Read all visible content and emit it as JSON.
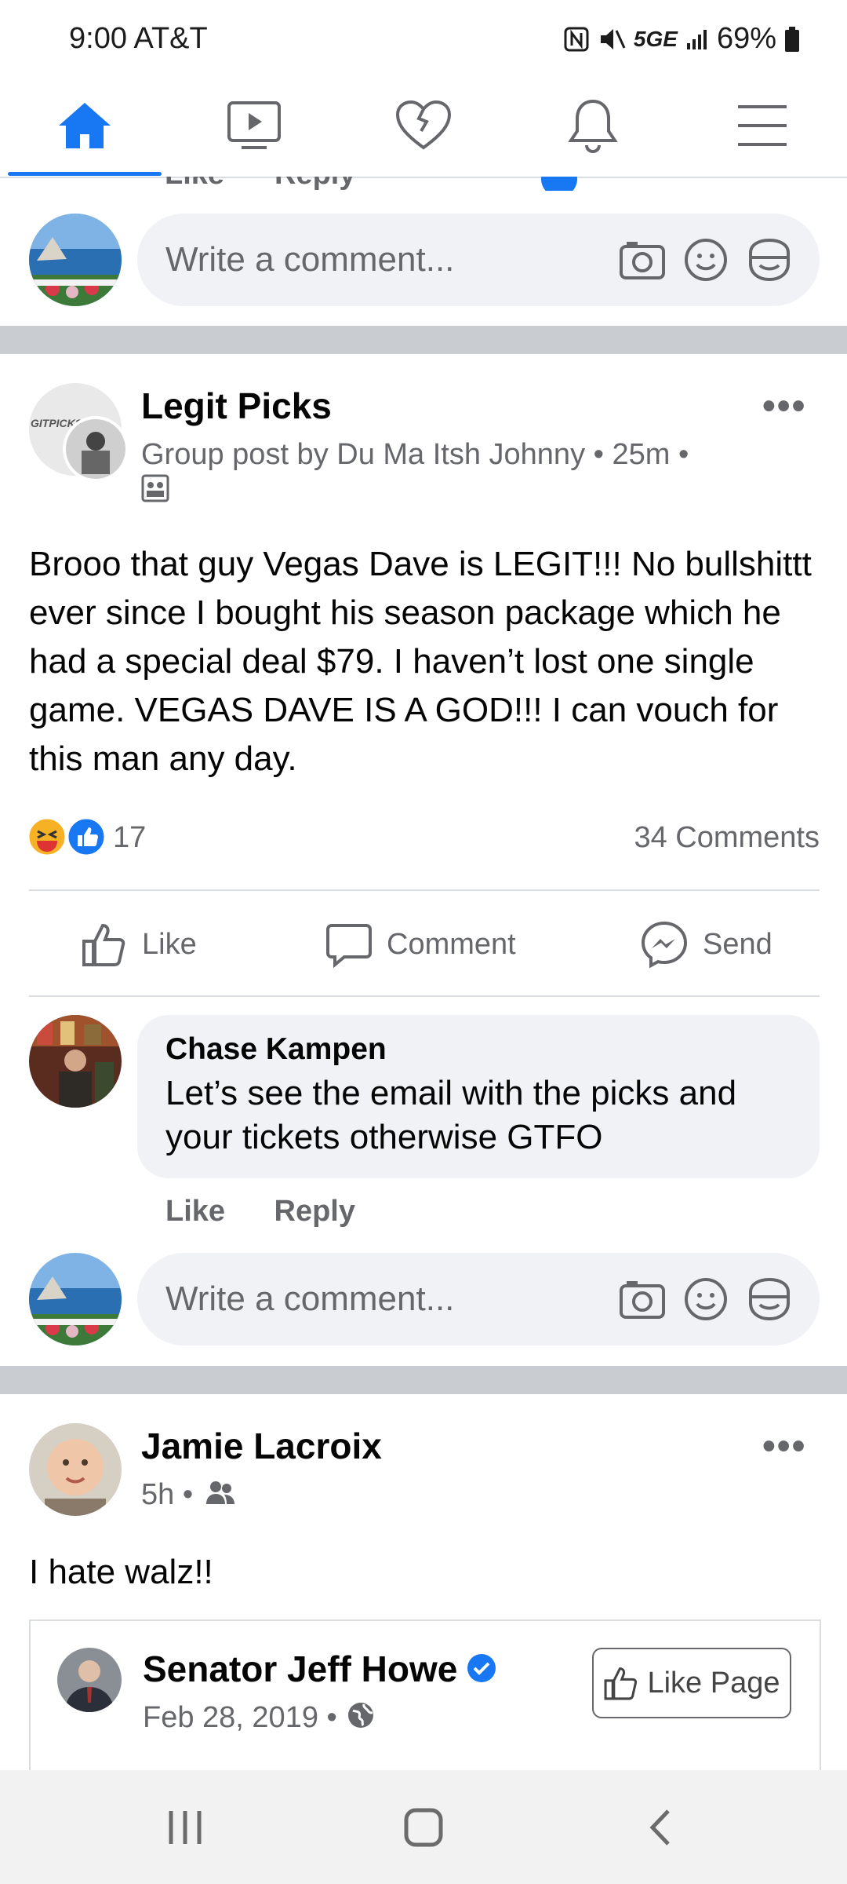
{
  "status_bar": {
    "time": "9:00",
    "carrier": "AT&T",
    "network": "5GE",
    "battery": "69%"
  },
  "tabs": [
    {
      "name": "home",
      "icon": "home-icon",
      "active": true
    },
    {
      "name": "watch",
      "icon": "video-icon",
      "active": false
    },
    {
      "name": "dating",
      "icon": "heart-icon",
      "active": false
    },
    {
      "name": "notifications",
      "icon": "bell-icon",
      "active": false
    },
    {
      "name": "menu",
      "icon": "hamburger-menu-icon",
      "active": false
    }
  ],
  "cut_row": {
    "like": "Like",
    "reply": "Reply"
  },
  "comment_placeholder": "Write a comment...",
  "post1": {
    "author": "Legit Picks",
    "avatar_text": "GITPICKS",
    "meta": "Group post by Du Ma Itsh Johnny • 25m •",
    "body": "Brooo that guy Vegas Dave is LEGIT!!! No bullshittt ever since I bought his season package which he had a special deal $79. I haven’t lost one single game. VEGAS DAVE IS A GOD!!! I can vouch for this man any day.",
    "reaction_count": "17",
    "comments_count": "34 Comments",
    "actions": {
      "like": "Like",
      "comment": "Comment",
      "send": "Send"
    },
    "comment": {
      "author": "Chase Kampen",
      "text": "Let’s see the email with the picks and your tickets otherwise GTFO",
      "like": "Like",
      "reply": "Reply"
    }
  },
  "post2": {
    "author": "Jamie Lacroix",
    "time": "5h •",
    "body": "I hate walz!!",
    "shared": {
      "author": "Senator Jeff Howe",
      "date": "Feb 28, 2019 •",
      "like_page": "Like Page"
    }
  },
  "colors": {
    "accent": "#1877f2",
    "secondary_text": "#65676b",
    "bubble_bg": "#f0f2f5",
    "divider": "#c9ccd1"
  }
}
